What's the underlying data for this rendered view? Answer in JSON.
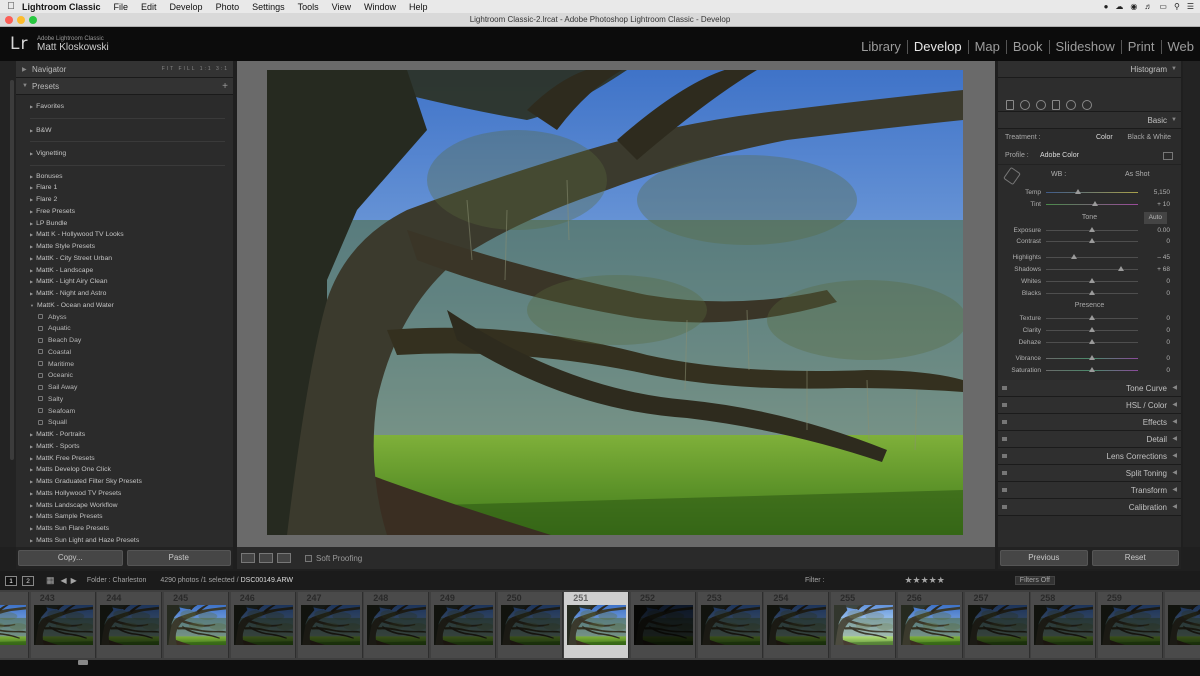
{
  "menubar": {
    "apple": "",
    "items": [
      "Lightroom Classic",
      "File",
      "Edit",
      "Develop",
      "Photo",
      "Settings",
      "Tools",
      "View",
      "Window",
      "Help"
    ]
  },
  "window": {
    "title": "Lightroom Classic-2.lrcat - Adobe Photoshop Lightroom Classic - Develop"
  },
  "identity": {
    "logo": "Lr",
    "app": "Adobe Lightroom Classic",
    "user": "Matt Kloskowski"
  },
  "modules": [
    "Library",
    "Develop",
    "Map",
    "Book",
    "Slideshow",
    "Print",
    "Web"
  ],
  "left_panel": {
    "navigator_label": "Navigator",
    "navigator_options": "FIT FILL 1:1 3:1",
    "presets_label": "Presets",
    "presets_plus": "+",
    "top_folders": [
      "Favorites",
      "B&W",
      "Vignetting"
    ],
    "folders": [
      "Bonuses",
      "Flare 1",
      "Flare 2",
      "Free Presets",
      "LP Bundle",
      "Matt K - Hollywood TV Looks",
      "Matte Style Presets",
      "MattK - City Street Urban",
      "MattK - Landscape",
      "MattK - Light Airy Clean",
      "MattK - Night and Astro",
      "MattK - Ocean and Water"
    ],
    "open_items": [
      "Abyss",
      "Aquatic",
      "Beach Day",
      "Coastal",
      "Maritime",
      "Oceanic",
      "Sail Away",
      "Salty",
      "Seafoam",
      "Squall"
    ],
    "more_folders": [
      "MattK - Portraits",
      "MattK - Sports",
      "MattK Free Presets",
      "Matts Develop One Click",
      "Matts Graduated Filter Sky Presets",
      "Matts Hollywood TV Presets",
      "Matts Landscape Workflow",
      "Matts Sample Presets",
      "Matts Sun Flare Presets",
      "Matts Sun Light and Haze Presets"
    ],
    "copy_button": "Copy...",
    "paste_button": "Paste"
  },
  "toolbar": {
    "soft_proofing": "Soft Proofing"
  },
  "right_panel": {
    "histogram": "Histogram",
    "basic": "Basic",
    "treatment_label": "Treatment :",
    "treatment_color": "Color",
    "treatment_bw": "Black & White",
    "profile_label": "Profile :",
    "profile_value": "Adobe Color",
    "wb_label": "WB :",
    "wb_value": "As Shot",
    "wb_sliders": [
      {
        "label": "Temp",
        "value": "5,150",
        "pos": 0.35
      },
      {
        "label": "Tint",
        "value": "+ 10",
        "pos": 0.53
      }
    ],
    "tone_label": "Tone",
    "auto_label": "Auto",
    "tone_sliders_a": [
      {
        "label": "Exposure",
        "value": "0.00",
        "pos": 0.5
      },
      {
        "label": "Contrast",
        "value": "0",
        "pos": 0.5
      }
    ],
    "tone_sliders_b": [
      {
        "label": "Highlights",
        "value": "– 45",
        "pos": 0.3
      },
      {
        "label": "Shadows",
        "value": "+ 68",
        "pos": 0.82
      },
      {
        "label": "Whites",
        "value": "0",
        "pos": 0.5
      },
      {
        "label": "Blacks",
        "value": "0",
        "pos": 0.5
      }
    ],
    "presence_label": "Presence",
    "presence_sliders_a": [
      {
        "label": "Texture",
        "value": "0",
        "pos": 0.5
      },
      {
        "label": "Clarity",
        "value": "0",
        "pos": 0.5
      },
      {
        "label": "Dehaze",
        "value": "0",
        "pos": 0.5
      }
    ],
    "presence_sliders_b": [
      {
        "label": "Vibrance",
        "value": "0",
        "pos": 0.5
      },
      {
        "label": "Saturation",
        "value": "0",
        "pos": 0.5
      }
    ],
    "collapsed_panels": [
      "Tone Curve",
      "HSL / Color",
      "Effects",
      "Detail",
      "Lens Corrections",
      "Split Toning",
      "Transform",
      "Calibration"
    ],
    "previous_button": "Previous",
    "reset_button": "Reset"
  },
  "filmbar": {
    "view1": "1",
    "view2": "2",
    "folder": "Folder : Charleston",
    "count": "4290 photos /1 selected /",
    "file": "DSC00149.ARW",
    "filter_label": "Filter :",
    "stars": "★★★★★",
    "filters_off": "Filters Off"
  },
  "filmstrip": {
    "frames": [
      {
        "num": "",
        "tone": "normal"
      },
      {
        "num": "243",
        "tone": "dark"
      },
      {
        "num": "244",
        "tone": "dark"
      },
      {
        "num": "245",
        "tone": "normal"
      },
      {
        "num": "246",
        "tone": "dark"
      },
      {
        "num": "247",
        "tone": "dark"
      },
      {
        "num": "248",
        "tone": "dark"
      },
      {
        "num": "249",
        "tone": "dark"
      },
      {
        "num": "250",
        "tone": "dark"
      },
      {
        "num": "251",
        "tone": "normal",
        "selected": true
      },
      {
        "num": "252",
        "tone": "vdark"
      },
      {
        "num": "253",
        "tone": "dark"
      },
      {
        "num": "254",
        "tone": "dark"
      },
      {
        "num": "255",
        "tone": "light"
      },
      {
        "num": "256",
        "tone": "normal"
      },
      {
        "num": "257",
        "tone": "dark"
      },
      {
        "num": "258",
        "tone": "dark"
      },
      {
        "num": "259",
        "tone": "dark"
      },
      {
        "num": "",
        "tone": "dark"
      }
    ]
  }
}
